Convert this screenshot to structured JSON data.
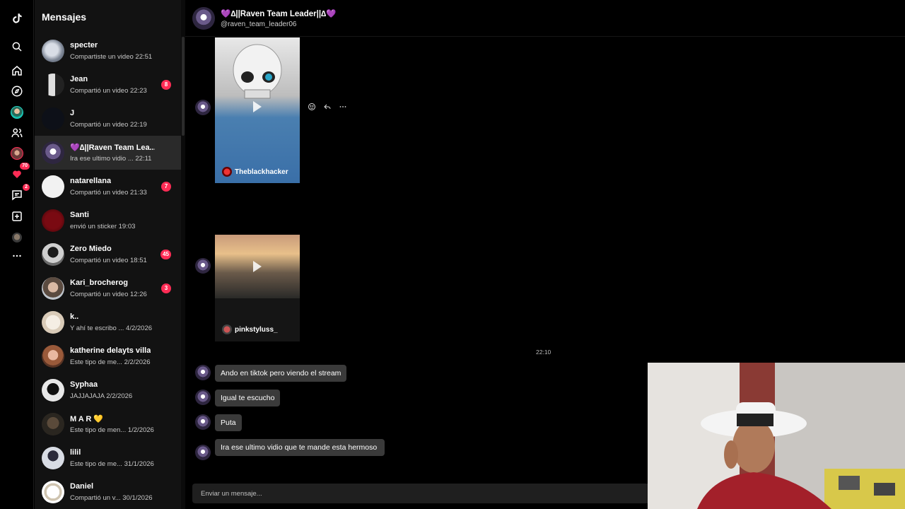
{
  "sidebar_rail": {
    "items": [
      {
        "name": "tiktok-logo"
      },
      {
        "name": "search-icon"
      },
      {
        "name": "home-icon"
      },
      {
        "name": "explore-icon"
      },
      {
        "name": "following-avatar"
      },
      {
        "name": "friends-icon"
      },
      {
        "name": "live-avatar"
      },
      {
        "name": "activity-icon",
        "badge": "70"
      },
      {
        "name": "messages-icon",
        "badge": "2"
      },
      {
        "name": "upload-icon"
      },
      {
        "name": "profile-avatar"
      },
      {
        "name": "more-icon"
      }
    ]
  },
  "list": {
    "title": "Mensajes",
    "conversations": [
      {
        "name": "specter",
        "preview": "Compartiste un video 22:51",
        "badge": ""
      },
      {
        "name": "Jean",
        "preview": "Compartió un video 22:23",
        "badge": "8"
      },
      {
        "name": "J",
        "preview": "Compartió un video 22:19",
        "badge": ""
      },
      {
        "name": "💜∆||Raven Team Lea...",
        "preview": "Ira ese ultimo vidio ...   22:11",
        "badge": ""
      },
      {
        "name": "natarellana",
        "preview": "Compartió un video 21:33",
        "badge": "7"
      },
      {
        "name": "Santi",
        "preview": "envió un sticker 19:03",
        "badge": ""
      },
      {
        "name": "Zero Miedo",
        "preview": "Compartió un video 18:51",
        "badge": "45"
      },
      {
        "name": "Kari_brocherog",
        "preview": "Compartió un video 12:26",
        "badge": "3"
      },
      {
        "name": "k..",
        "preview": "Y ahí te escribo ...  4/2/2026",
        "badge": ""
      },
      {
        "name": "katherine delayts villa",
        "preview": "Este tipo de me...  2/2/2026",
        "badge": ""
      },
      {
        "name": "Syphaa",
        "preview": "JAJJAJAJA 2/2/2026",
        "badge": ""
      },
      {
        "name": "M A R 💛",
        "preview": "Este tipo de men... 1/2/2026",
        "badge": ""
      },
      {
        "name": "lilil",
        "preview": "Este tipo de me... 31/1/2026",
        "badge": ""
      },
      {
        "name": "Daniel",
        "preview": "Compartió un v... 30/1/2026",
        "badge": ""
      }
    ]
  },
  "chat": {
    "header_name": "💜∆||Raven Team Leader||∆💜",
    "header_handle": "@raven_team_leader06",
    "videos": [
      {
        "owner": "Theblackhacker"
      },
      {
        "owner": "pinkstyluss_"
      }
    ],
    "timestamp": "22:10",
    "messages": [
      "Ando en tiktok pero viendo el stream",
      "Igual te escucho",
      "Puta",
      "Ira ese ultimo vidio que te mande esta hermoso"
    ],
    "composer_placeholder": "Enviar un mensaje..."
  },
  "colors": {
    "accent": "#fe2c55",
    "background": "#000000",
    "list_bg": "#121212",
    "bubble_bg": "#3a3a3a"
  }
}
